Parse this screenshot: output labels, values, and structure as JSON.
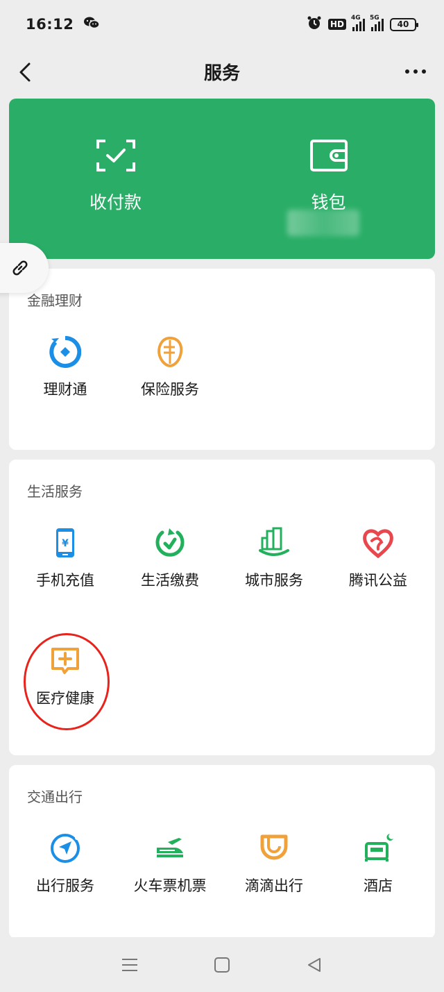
{
  "status": {
    "time": "16:12",
    "hd_label": "HD",
    "net1": "4G",
    "net2": "5G",
    "battery": "40"
  },
  "nav": {
    "title": "服务"
  },
  "top_card": {
    "pay_label": "收付款",
    "wallet_label": "钱包"
  },
  "finance": {
    "title": "金融理财",
    "items": [
      {
        "label": "理财通",
        "icon": "licaitong-icon"
      },
      {
        "label": "保险服务",
        "icon": "insurance-icon"
      }
    ]
  },
  "life": {
    "title": "生活服务",
    "items": [
      {
        "label": "手机充值",
        "icon": "phone-recharge-icon"
      },
      {
        "label": "生活缴费",
        "icon": "utility-payment-icon"
      },
      {
        "label": "城市服务",
        "icon": "city-service-icon"
      },
      {
        "label": "腾讯公益",
        "icon": "tencent-charity-icon"
      },
      {
        "label": "医疗健康",
        "icon": "medical-health-icon"
      }
    ]
  },
  "transport": {
    "title": "交通出行",
    "items": [
      {
        "label": "出行服务",
        "icon": "travel-service-icon"
      },
      {
        "label": "火车票机票",
        "icon": "train-flight-icon"
      },
      {
        "label": "滴滴出行",
        "icon": "didi-icon"
      },
      {
        "label": "酒店",
        "icon": "hotel-icon"
      }
    ]
  },
  "colors": {
    "green": "#2aae67",
    "highlight": "#e8231b",
    "blue": "#1b8fe6",
    "orange": "#f0a13a",
    "green_icon": "#22b05c",
    "red_icon": "#e8474d"
  }
}
